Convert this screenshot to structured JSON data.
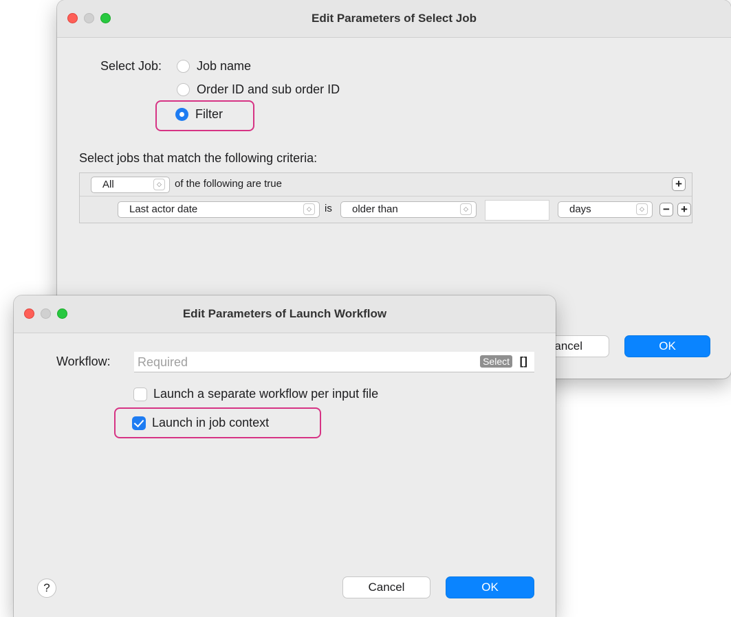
{
  "select_job_window": {
    "title": "Edit Parameters of Select Job",
    "select_job_label": "Select Job:",
    "options": [
      "Job name",
      "Order ID and sub order ID",
      "Filter"
    ],
    "selected_option": "Filter",
    "criteria_heading": "Select jobs that match the following criteria:",
    "match_mode": "All",
    "match_suffix": "of the following are true",
    "rule": {
      "field": "Last actor date",
      "operator_label": "is",
      "comparison": "older than",
      "value": "",
      "unit": "days"
    },
    "cancel_partial": "ancel",
    "ok_label": "OK"
  },
  "launch_workflow_window": {
    "title": "Edit Parameters of Launch Workflow",
    "workflow_label": "Workflow:",
    "workflow_placeholder": "Required",
    "select_label": "Select",
    "bracket_label": "[]",
    "options": [
      {
        "label": "Launch a separate workflow per input file",
        "checked": false
      },
      {
        "label": "Launch in job context",
        "checked": true
      }
    ],
    "help_label": "?",
    "cancel_label": "Cancel",
    "ok_label": "OK"
  },
  "colors": {
    "accent": "#0a84ff",
    "highlight": "#d63384",
    "traffic_red": "#fe5f57",
    "traffic_green": "#28c840"
  },
  "icons": [
    "close-window-icon",
    "minimize-window-icon",
    "zoom-window-icon",
    "chevron-updown-icon",
    "plus-icon",
    "minus-icon",
    "checkmark-icon",
    "help-icon"
  ]
}
